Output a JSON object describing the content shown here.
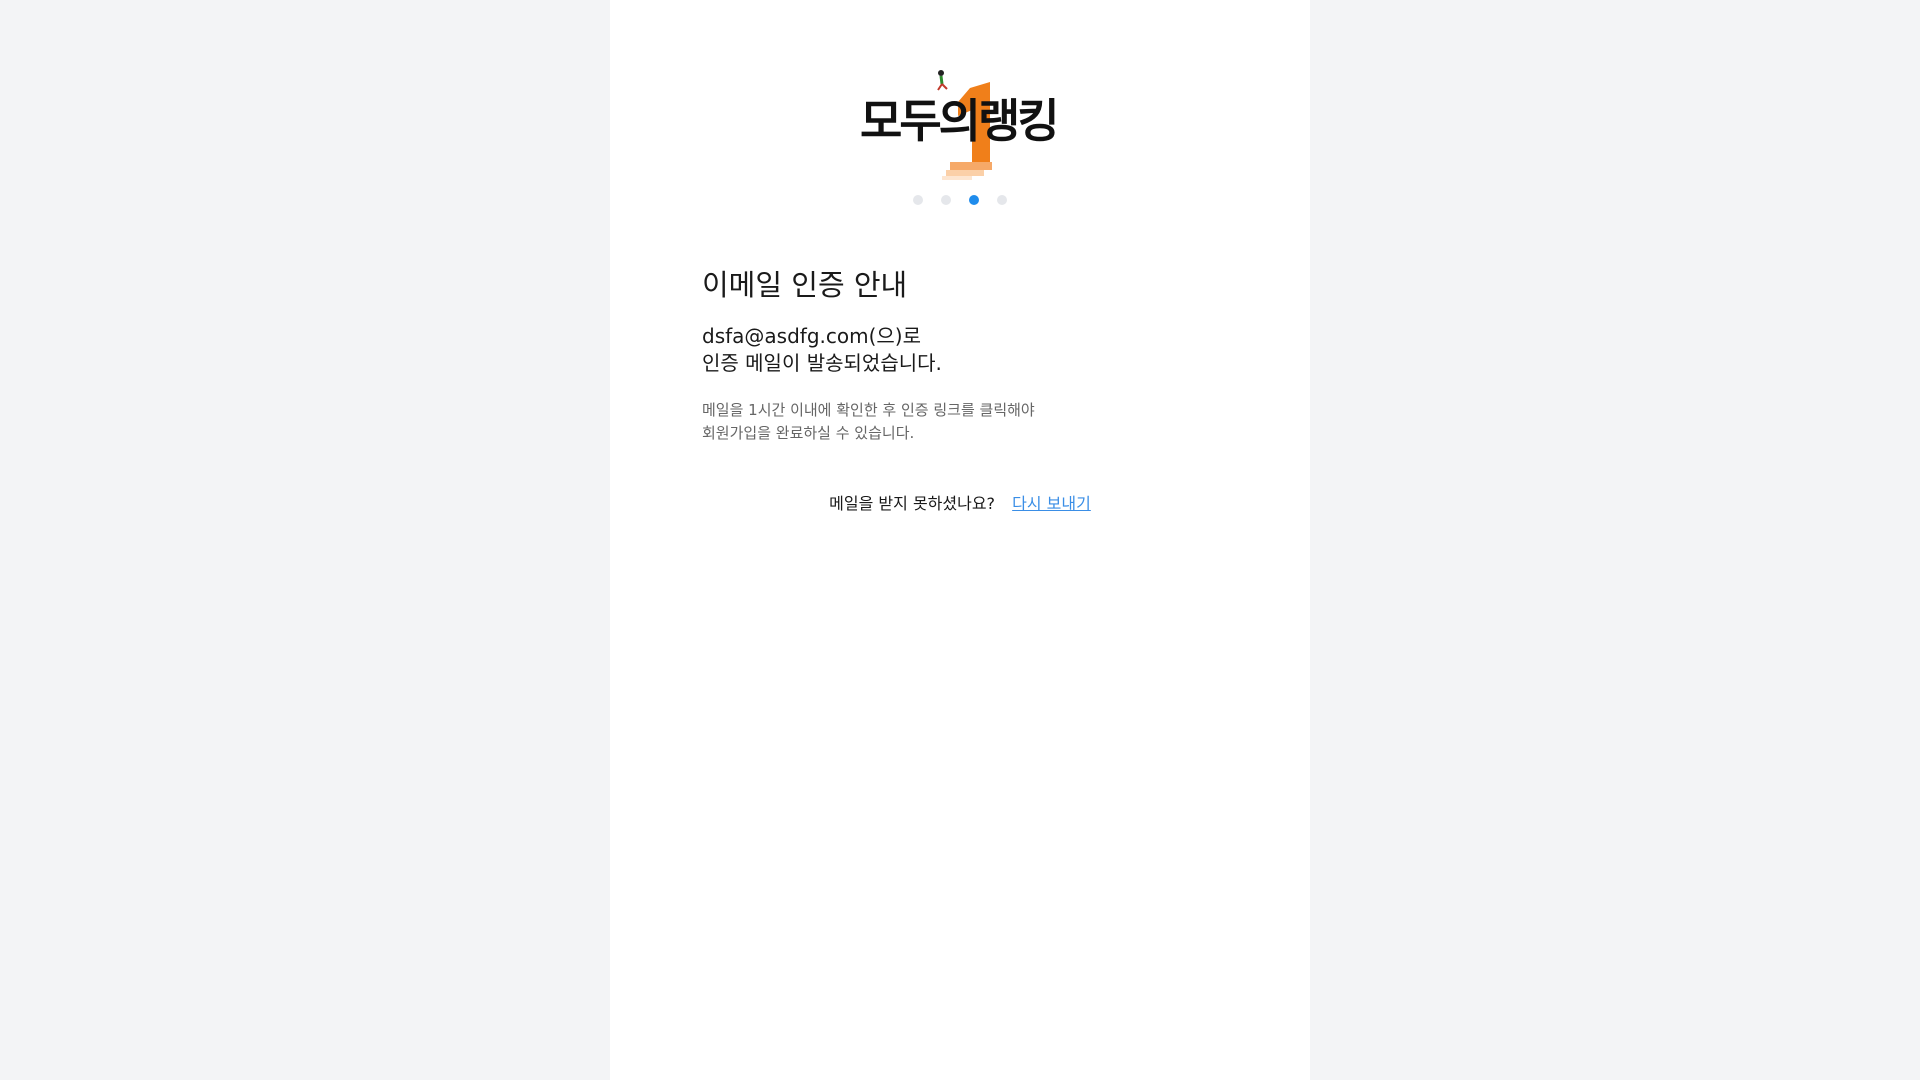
{
  "logo": {
    "text": "모두의랭킹",
    "accent_color": "#f07f1a"
  },
  "stepper": {
    "total": 4,
    "current": 3,
    "active_color": "#1f8cec",
    "inactive_color": "#e5e7eb"
  },
  "main": {
    "title": "이메일 인증 안내",
    "sent_line1": "dsfa@asdfg.com(으)로",
    "sent_line2": "인증 메일이 발송되었습니다.",
    "info_line1": "메일을 1시간 이내에 확인한 후 인증 링크를 클릭해야",
    "info_line2": "회원가입을 완료하실 수 있습니다."
  },
  "resend": {
    "question": "메일을 받지 못하셨나요?",
    "link_label": "다시 보내기",
    "link_color": "#3a8ee6"
  }
}
